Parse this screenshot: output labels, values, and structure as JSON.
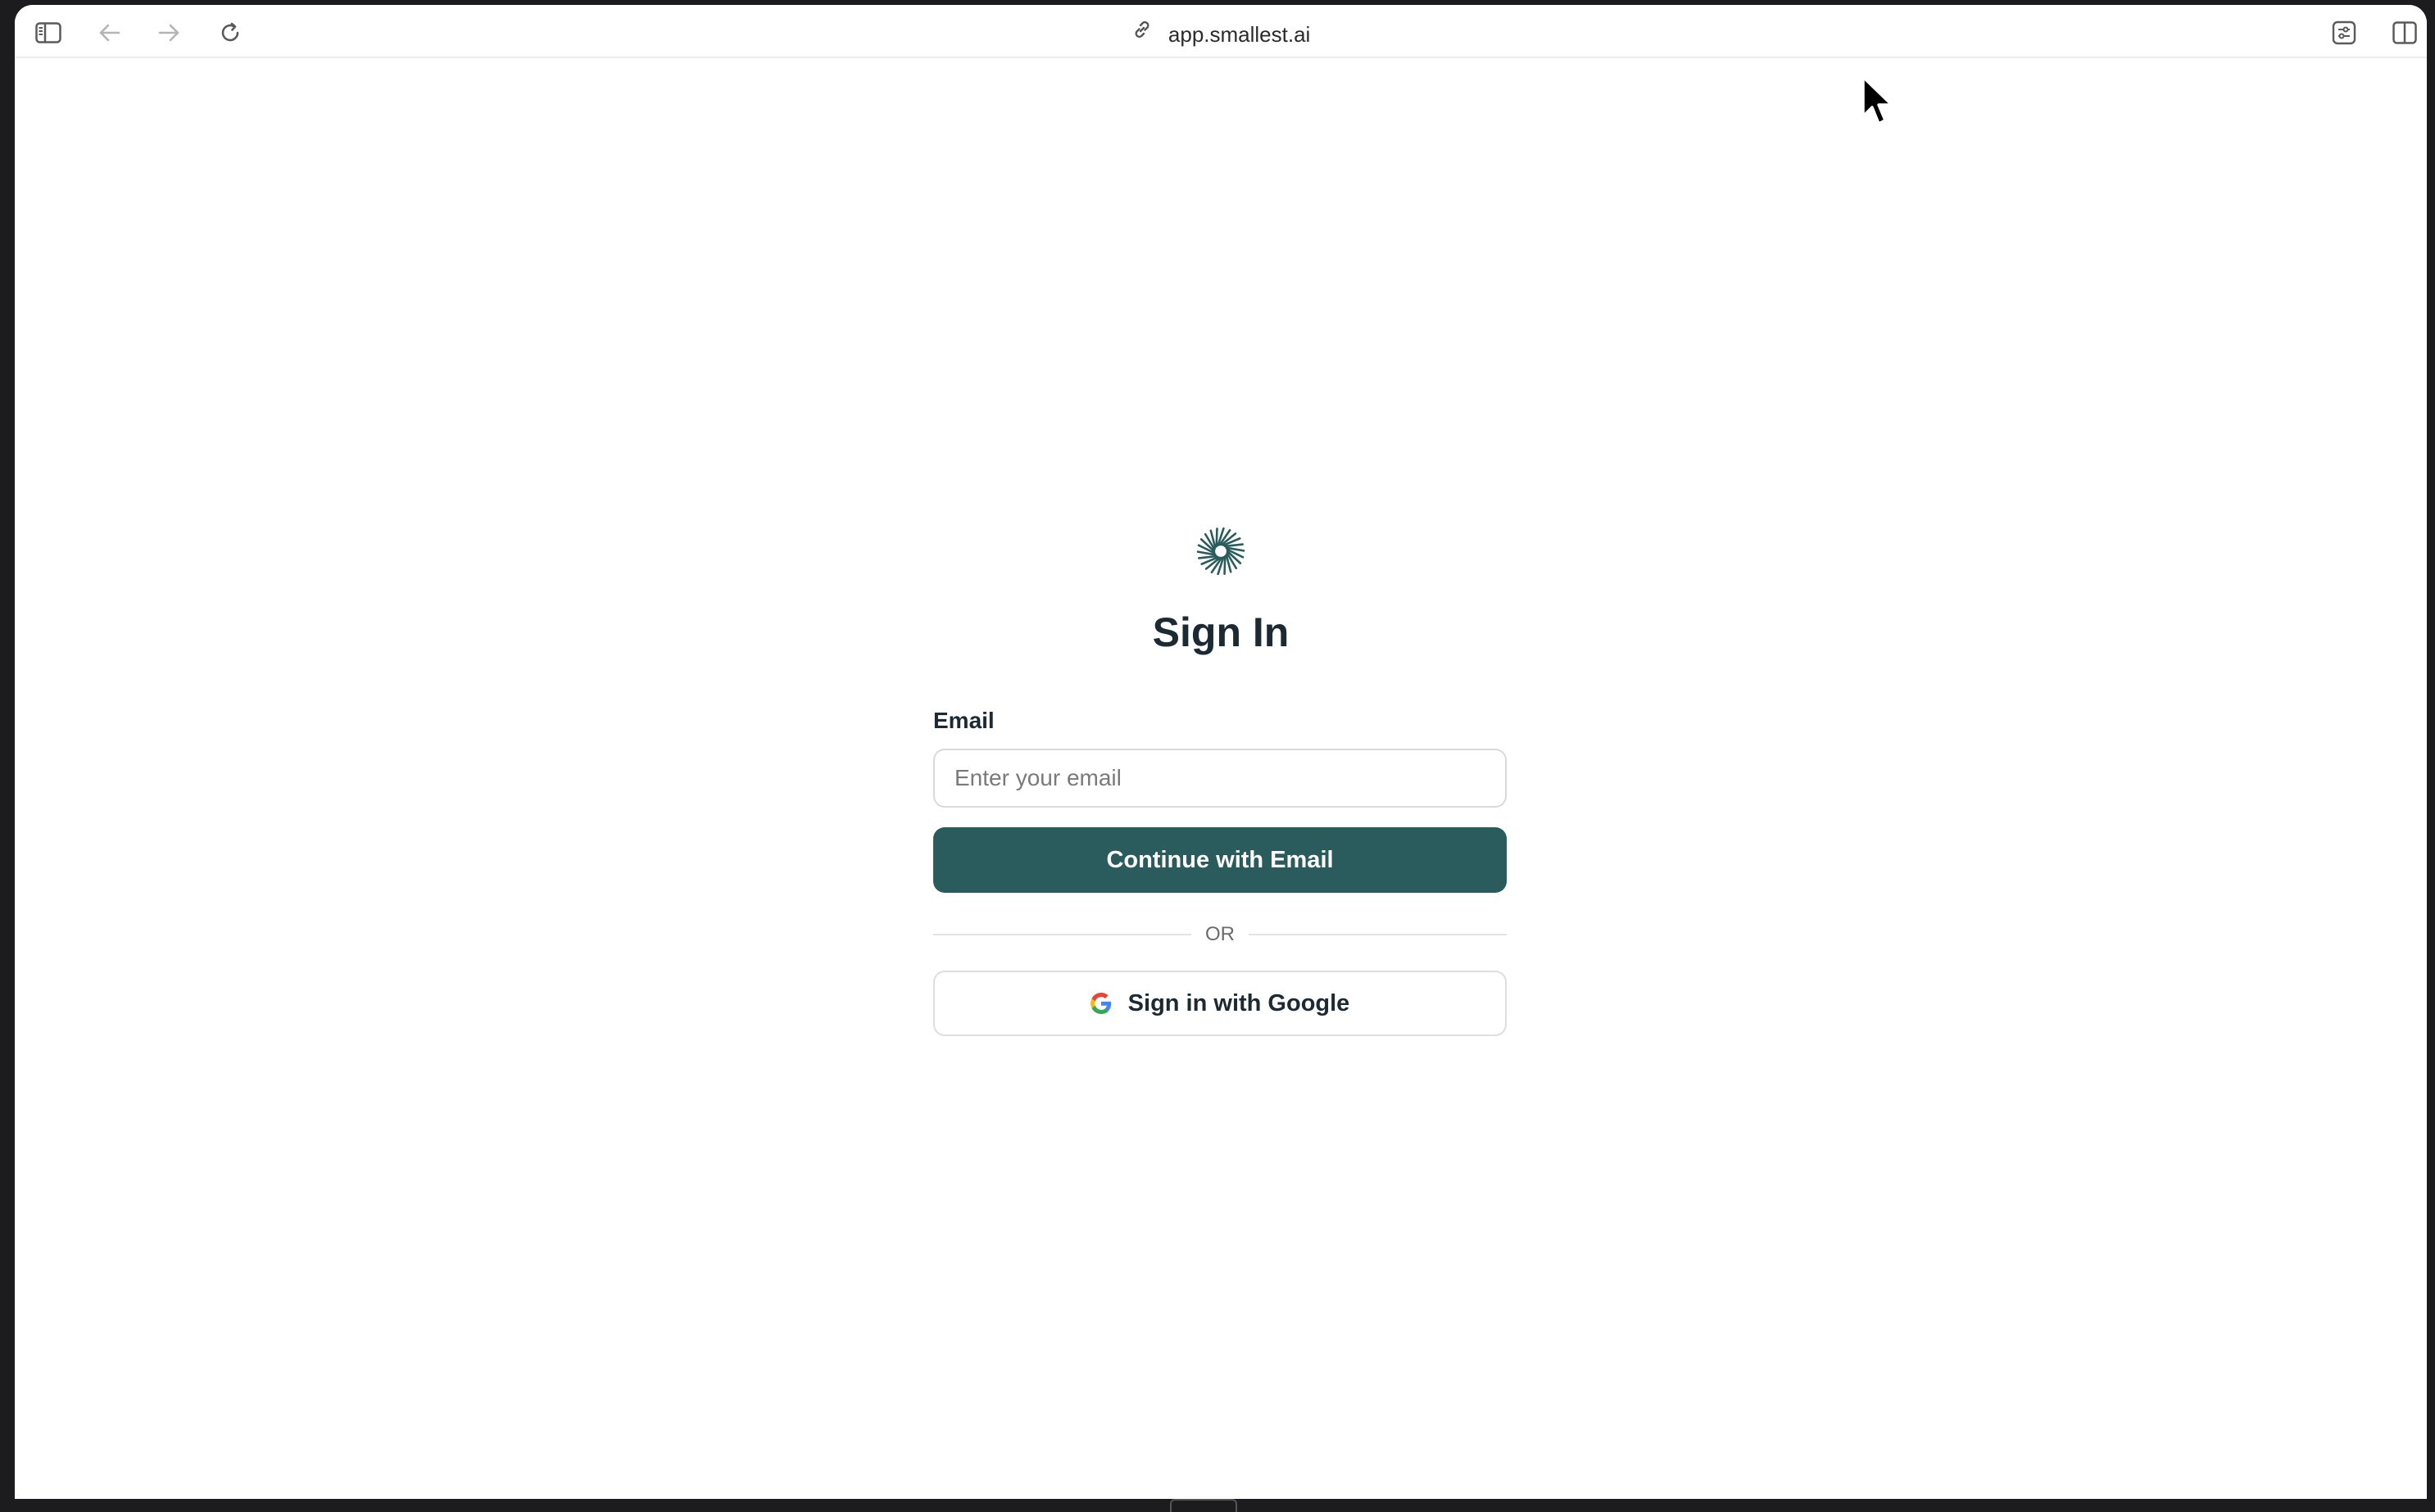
{
  "browser": {
    "url": "app.smallest.ai",
    "icons": {
      "sidebar": "sidebar-toggle-icon",
      "back": "arrow-left-icon",
      "forward": "arrow-right-icon",
      "reload": "reload-icon",
      "link": "link-icon",
      "extensions": "sliders-icon",
      "split_view": "split-view-icon"
    }
  },
  "signin": {
    "title": "Sign In",
    "email_label": "Email",
    "email_placeholder": "Enter your email",
    "email_value": "",
    "continue_label": "Continue with Email",
    "divider_label": "OR",
    "google_label": "Sign in with Google"
  },
  "colors": {
    "primary": "#2b5c5d",
    "title_text": "#1c2a33",
    "border": "#d9d9d9"
  }
}
